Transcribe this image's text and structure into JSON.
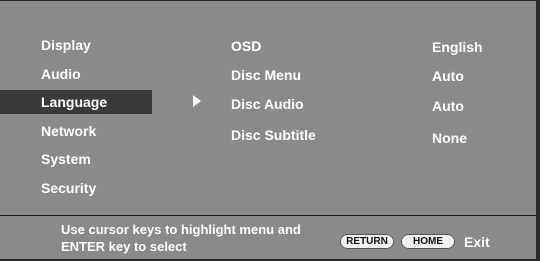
{
  "menu": {
    "items": [
      {
        "label": "Display"
      },
      {
        "label": "Audio"
      },
      {
        "label": "Language"
      },
      {
        "label": "Network"
      },
      {
        "label": "System"
      },
      {
        "label": "Security"
      }
    ],
    "selected": "Language"
  },
  "settings": [
    {
      "name": "OSD",
      "value": "English"
    },
    {
      "name": "Disc Menu",
      "value": "Auto"
    },
    {
      "name": "Disc Audio",
      "value": "Auto"
    },
    {
      "name": "Disc Subtitle",
      "value": "None"
    }
  ],
  "footer": {
    "hint_line1": "Use cursor keys to highlight menu and",
    "hint_line2": "ENTER key to select",
    "return_label": "RETURN",
    "home_label": "HOME",
    "exit_label": "Exit"
  },
  "colors": {
    "panel_bg": "#8a8a8a",
    "selected_bg": "#3a3a3a",
    "text": "#ffffff"
  }
}
